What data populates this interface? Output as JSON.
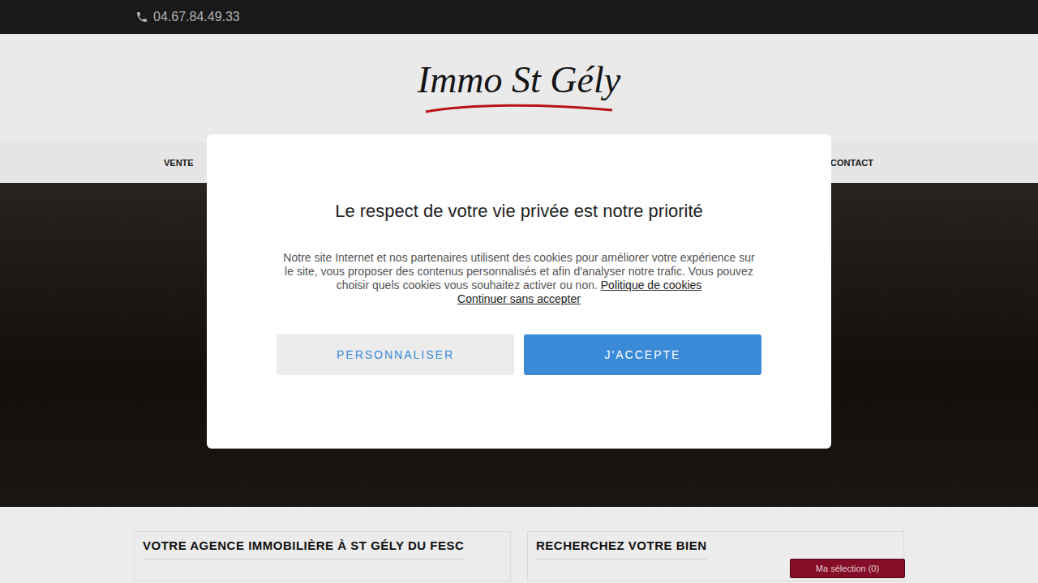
{
  "topbar": {
    "phone": "04.67.84.49.33"
  },
  "logo": {
    "text": "Immo St Gély"
  },
  "nav": [
    {
      "label": "VENTE"
    },
    {
      "label": "CONTACT"
    }
  ],
  "sections": [
    {
      "title": "VOTRE AGENCE IMMOBILIÈRE À ST GÉLY DU FESC"
    },
    {
      "title": "RECHERCHEZ VOTRE BIEN"
    }
  ],
  "selection_button": "Ma sélection (0)",
  "cookie_dialog": {
    "title": "Le respect de votre vie privée est notre priorité",
    "text": "Notre site Internet et nos partenaires utilisent des cookies pour améliorer votre expérience sur le site, vous proposer des contenus personnalisés et afin d'analyser notre trafic. Vous pouvez choisir quels cookies vous souhaitez activer ou non.",
    "policy_link": "Politique de cookies",
    "skip_link": "Continuer sans accepter",
    "buttons": [
      {
        "label": "PERSONNALISER",
        "primary": false
      },
      {
        "label": "J'ACCEPTE",
        "primary": true
      }
    ]
  }
}
